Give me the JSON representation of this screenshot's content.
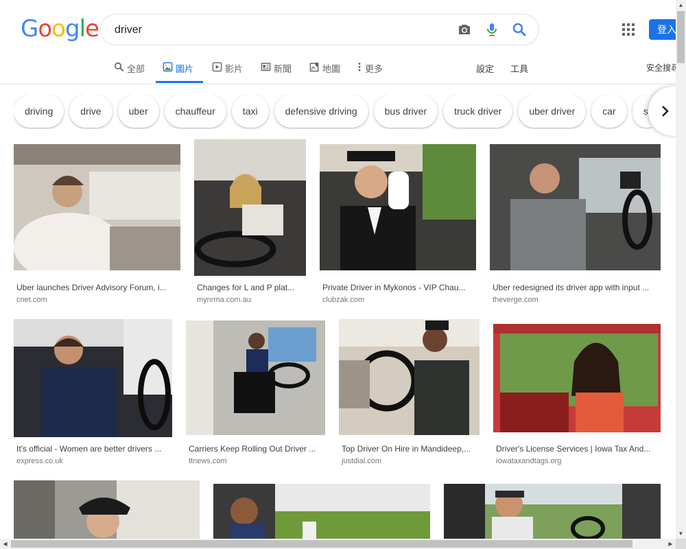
{
  "logo": {
    "text": "Google"
  },
  "search": {
    "query": "driver"
  },
  "header": {
    "signin_label": "登入"
  },
  "tabs": [
    {
      "label": "全部",
      "icon": "search-icon"
    },
    {
      "label": "圖片",
      "icon": "image-icon",
      "active": true
    },
    {
      "label": "影片",
      "icon": "video-icon"
    },
    {
      "label": "新聞",
      "icon": "news-icon"
    },
    {
      "label": "地圖",
      "icon": "map-icon"
    },
    {
      "label": "更多",
      "icon": "more-vert-icon"
    }
  ],
  "tools": {
    "settings": "設定",
    "tools": "工具",
    "safesearch": "安全搜尋"
  },
  "chips": [
    "driving",
    "drive",
    "uber",
    "chauffeur",
    "taxi",
    "defensive driving",
    "bus driver",
    "truck driver",
    "uber driver",
    "car",
    "si"
  ],
  "results": [
    {
      "caption": "Uber launches Driver Advisory Forum, i...",
      "source": "cnet.com"
    },
    {
      "caption": "Changes for L and P plat...",
      "source": "mynrma.com.au"
    },
    {
      "caption": "Private Driver in Mykonos - VIP Chau...",
      "source": "clubzak.com"
    },
    {
      "caption": "Uber redesigned its driver app with input ...",
      "source": "theverge.com"
    },
    {
      "caption": "It's official - Women are better drivers ...",
      "source": "express.co.uk"
    },
    {
      "caption": "Carriers Keep Rolling Out Driver ...",
      "source": "ttnews.com"
    },
    {
      "caption": "Top Driver On Hire in Mandideep,...",
      "source": "justdial.com"
    },
    {
      "caption": "Driver's License Services | Iowa Tax And...",
      "source": "iowataxandtags.org"
    },
    {
      "caption": "",
      "source": ""
    },
    {
      "caption": "",
      "source": ""
    },
    {
      "caption": "",
      "source": ""
    }
  ],
  "colors": {
    "accent": "#1a73e8",
    "logo": [
      "#4285f4",
      "#ea4335",
      "#fbbc05",
      "#4285f4",
      "#34a853",
      "#ea4335"
    ]
  }
}
